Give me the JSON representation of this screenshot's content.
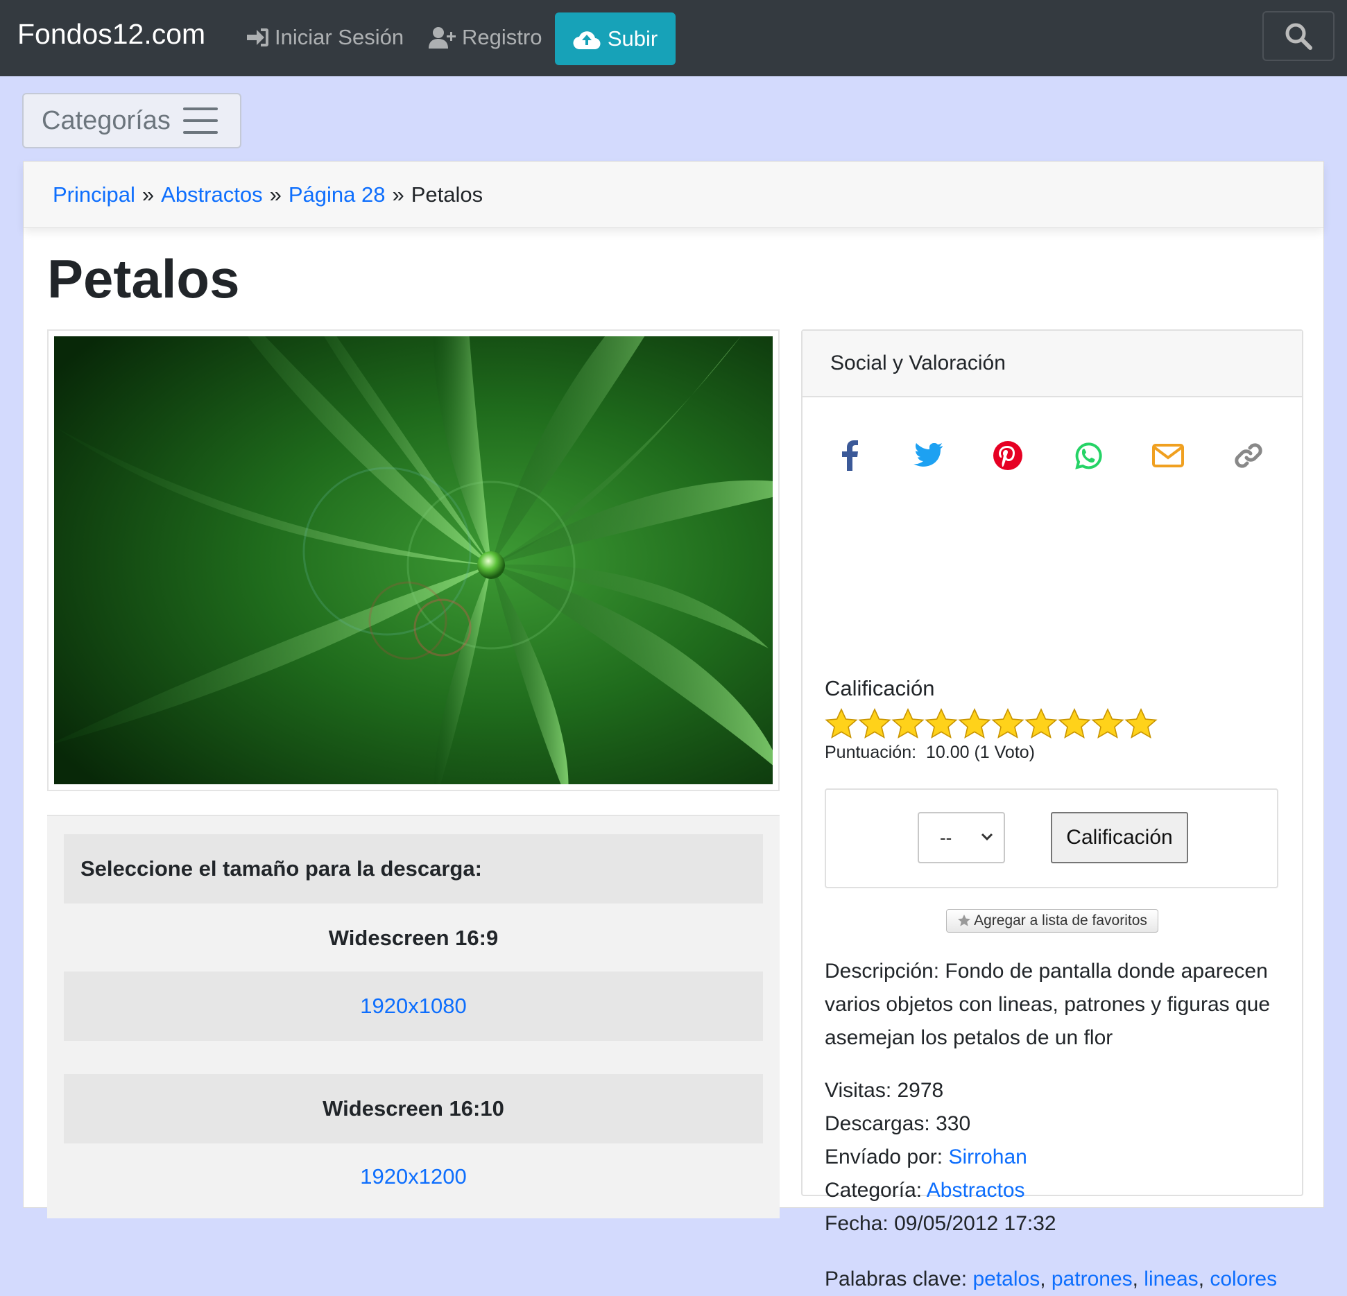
{
  "navbar": {
    "brand": "Fondos12.com",
    "login_label": "Iniciar Sesión",
    "register_label": "Registro",
    "upload_label": "Subir"
  },
  "categories_toggle": {
    "label": "Categorías"
  },
  "breadcrumb": [
    {
      "label": "Principal"
    },
    {
      "label": "Abstractos"
    },
    {
      "label": "Página 28"
    },
    {
      "label": "Petalos"
    }
  ],
  "breadcrumb_separator": "»",
  "page_title": "Petalos",
  "download": {
    "header": "Seleccione el tamaño para la descarga:",
    "groups": [
      {
        "name": "Widescreen 16:9",
        "size": "1920x1080"
      },
      {
        "name": "Widescreen 16:10",
        "size": "1920x1200"
      }
    ]
  },
  "social": {
    "title": "Social y Valoración",
    "icons": [
      "facebook-icon",
      "twitter-icon",
      "pinterest-icon",
      "whatsapp-icon",
      "email-icon",
      "link-icon"
    ],
    "colors": {
      "facebook": "#3b5998",
      "twitter": "#1da1f2",
      "pinterest": "#e60023",
      "whatsapp": "#25d366",
      "email": "#f0a020",
      "link": "#888888"
    }
  },
  "rating": {
    "label": "Calificación",
    "stars": 10,
    "score_label": "Puntuación:",
    "score_value": "10.00 (1 Voto)",
    "select_value": "--",
    "button_label": "Calificación",
    "favorites_label": "Agregar a lista de favoritos"
  },
  "description": "Descripción: Fondo de pantalla donde aparecen varios objetos con lineas, patrones y figuras que asemejan los petalos de un flor",
  "meta": {
    "visits_label": "Visitas:",
    "visits": "2978",
    "downloads_label": "Descargas:",
    "downloads": "330",
    "sent_by_label": "Envíado por:",
    "sent_by": "Sirrohan",
    "category_label": "Categoría:",
    "category": "Abstractos",
    "date_label": "Fecha:",
    "date": "09/05/2012 17:32"
  },
  "keywords": {
    "label": "Palabras clave:",
    "items": [
      "petalos",
      "patrones",
      "lineas",
      "colores"
    ]
  }
}
